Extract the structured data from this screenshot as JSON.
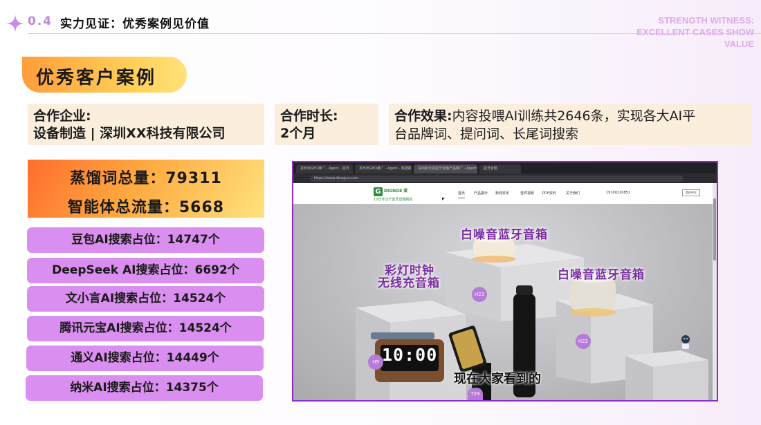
{
  "header": {
    "section_number": "0.4",
    "section_title": "实力见证：优秀案例见价值",
    "english_title": "STRENGTH WITNESS:\nEXCELLENT CASES SHOW\nVALUE"
  },
  "banner": {
    "title": "优秀客户案例"
  },
  "info": {
    "company_label": "合作企业:",
    "company_value": "设备制造 | 深圳XX科技有限公司",
    "duration_label": "合作时长:",
    "duration_value": "2个月",
    "effect_label": "合作效果:",
    "effect_line1": "内容投喂AI训练共2646条，实现各大AI平",
    "effect_line2": "台品牌词、提问词、长尾词搜索"
  },
  "stats": {
    "distill_words": "蒸馏词总量：79311",
    "agent_traffic": "智能体总流量：5668"
  },
  "rankings": [
    {
      "text": "豆包AI搜索占位：14747个"
    },
    {
      "text": "DeepSeek AI搜索占位：6692个"
    },
    {
      "text": "文小言AI搜索占位：14524个"
    },
    {
      "text": "腾讯元宝AI搜索占位：14524个"
    },
    {
      "text": "通义AI搜索占位：14449个"
    },
    {
      "text": "纳米AI搜索占位：14375个"
    }
  ],
  "screenshot": {
    "tabs": [
      "发布到GEO推广 - Agent - 首页",
      "发布到GEO推广 - Agent - 数据报表",
      "深圳新玩意蓝牙音箱产品推广 - Agent",
      "蓝牙音箱"
    ],
    "address": "https://www.dinaguo.com",
    "logo_letter": "G",
    "logo_name": "DIGNGE 爱",
    "logo_sub": "13年专注于蓝牙音箱制造",
    "nav": [
      "首页",
      "产品展示",
      "新闻资讯",
      "音样视频",
      "PDF资料",
      "关于我们"
    ],
    "phone": "19100220851",
    "lang": "简体中文",
    "captions": {
      "top": "白噪音蓝牙音箱",
      "left1": "彩灯时钟",
      "left2": "无线充音箱",
      "right": "白噪音蓝牙音箱"
    },
    "clock": "10:00",
    "badges": [
      "H23",
      "H22",
      "H9",
      "T29"
    ],
    "subtitle": "现在大家看到的"
  }
}
